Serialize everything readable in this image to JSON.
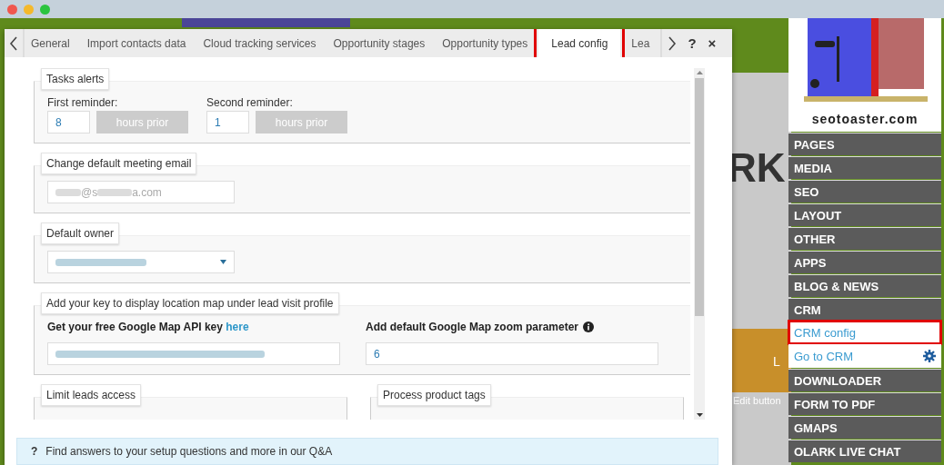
{
  "dialog": {
    "tabs": [
      {
        "label": "General",
        "selected": false,
        "annotated": false
      },
      {
        "label": "Import contacts data",
        "selected": false,
        "annotated": false
      },
      {
        "label": "Cloud tracking services",
        "selected": false,
        "annotated": false
      },
      {
        "label": "Opportunity stages",
        "selected": false,
        "annotated": false
      },
      {
        "label": "Opportunity types",
        "selected": false,
        "annotated": false
      },
      {
        "label": "Lead config",
        "selected": true,
        "annotated": true
      },
      {
        "label": "Lea",
        "selected": false,
        "annotated": false
      }
    ],
    "help": "?",
    "close": "×",
    "sections": [
      {
        "kind": "reminders",
        "legend": "Tasks alerts",
        "reminders": [
          {
            "label": "First reminder:",
            "value": "8",
            "unit": "hours prior"
          },
          {
            "label": "Second reminder:",
            "value": "1",
            "unit": "hours prior"
          }
        ]
      },
      {
        "kind": "email",
        "legend": "Change default meeting email",
        "value_start": "@s",
        "value_end": "a.com"
      },
      {
        "kind": "owner",
        "legend": "Default owner"
      },
      {
        "kind": "map",
        "legend": "Add your key to display location map under lead visit profile",
        "key_label": "Get your free Google Map API key",
        "key_link": "here",
        "zoom_label": "Add default Google Map zoom parameter",
        "zoom_value": "6"
      },
      {
        "kind": "pair",
        "legends": [
          "Limit leads access",
          "Process product tags"
        ]
      }
    ],
    "footer": {
      "icon": "?",
      "text": "Find answers to your setup questions and more in our Q&A"
    }
  },
  "background": {
    "heading": "RK",
    "label": "L",
    "edit": "Edit button"
  },
  "sidebar": {
    "logo": "seotoaster.com",
    "items": [
      {
        "label": "PAGES",
        "kind": "section",
        "annotated": false
      },
      {
        "label": "MEDIA",
        "kind": "section",
        "annotated": false
      },
      {
        "label": "SEO",
        "kind": "section",
        "annotated": false
      },
      {
        "label": "LAYOUT",
        "kind": "section",
        "annotated": false
      },
      {
        "label": "OTHER",
        "kind": "section",
        "annotated": false
      },
      {
        "label": "APPS",
        "kind": "section",
        "annotated": false
      },
      {
        "label": "BLOG & NEWS",
        "kind": "section",
        "annotated": false
      },
      {
        "label": "CRM",
        "kind": "section",
        "annotated": false
      },
      {
        "label": "CRM config",
        "kind": "link",
        "annotated": true
      },
      {
        "label": "Go to CRM",
        "kind": "link-gear",
        "annotated": false
      },
      {
        "label": "DOWNLOADER",
        "kind": "section",
        "annotated": false
      },
      {
        "label": "FORM TO PDF",
        "kind": "section",
        "annotated": false
      },
      {
        "label": "GMAPS",
        "kind": "section",
        "annotated": false
      },
      {
        "label": "OLARK LIVE CHAT",
        "kind": "section",
        "annotated": false
      }
    ]
  }
}
